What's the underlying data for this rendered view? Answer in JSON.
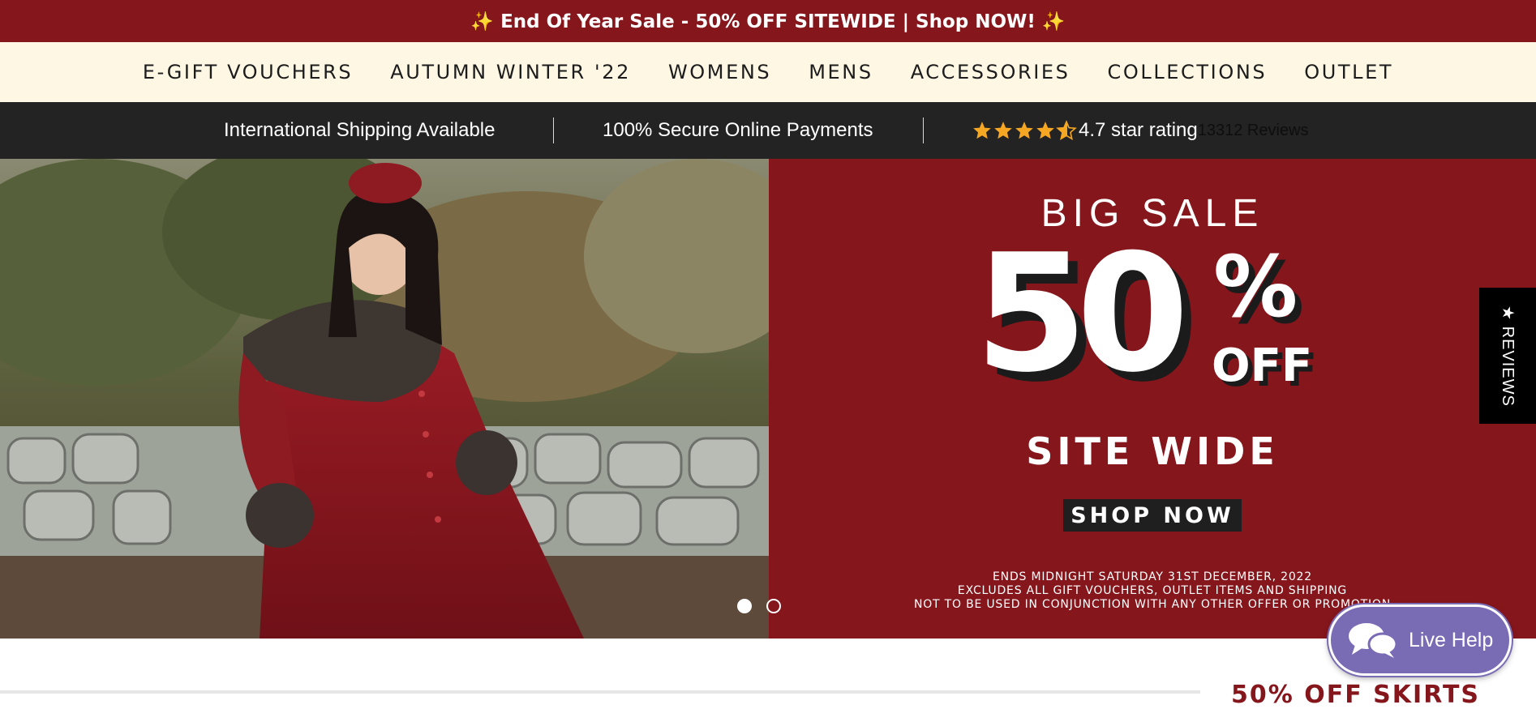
{
  "announcement": {
    "text": "✨ End Of Year Sale - 50% OFF SITEWIDE | Shop NOW! ✨"
  },
  "nav": {
    "items": [
      "E-GIFT VOUCHERS",
      "AUTUMN WINTER '22",
      "WOMENS",
      "MENS",
      "ACCESSORIES",
      "COLLECTIONS",
      "OUTLET"
    ]
  },
  "trust_bar": {
    "shipping": "International Shipping Available",
    "payments": "100% Secure Online Payments",
    "rating_value": 4.7,
    "rating_text": "4.7 star rating",
    "reviews_count": "13312 Reviews",
    "star_color": "#f5a623"
  },
  "hero": {
    "big_sale": "BIG SALE",
    "percent": "50",
    "percent_sign": "%",
    "off": "OFF",
    "site_wide": "SITE WIDE",
    "shop_now": "SHOP NOW",
    "fine_print": [
      "ENDS MIDNIGHT SATURDAY 31ST DECEMBER, 2022",
      "EXCLUDES ALL GIFT VOUCHERS, OUTLET ITEMS AND SHIPPING",
      "NOT TO BE USED IN CONJUNCTION WITH ANY OTHER OFFER OR PROMOTION"
    ],
    "slides": 2,
    "active_slide": 1
  },
  "reviews_tab": {
    "label": "★ REVIEWS"
  },
  "live_help": {
    "label": "Live Help"
  },
  "below": {
    "heading": "50% OFF SKIRTS"
  },
  "colors": {
    "brand": "#85161c",
    "nav_bg": "#fdf7e4",
    "trust_bg": "#232323",
    "live_help": "#7a6bb5"
  }
}
